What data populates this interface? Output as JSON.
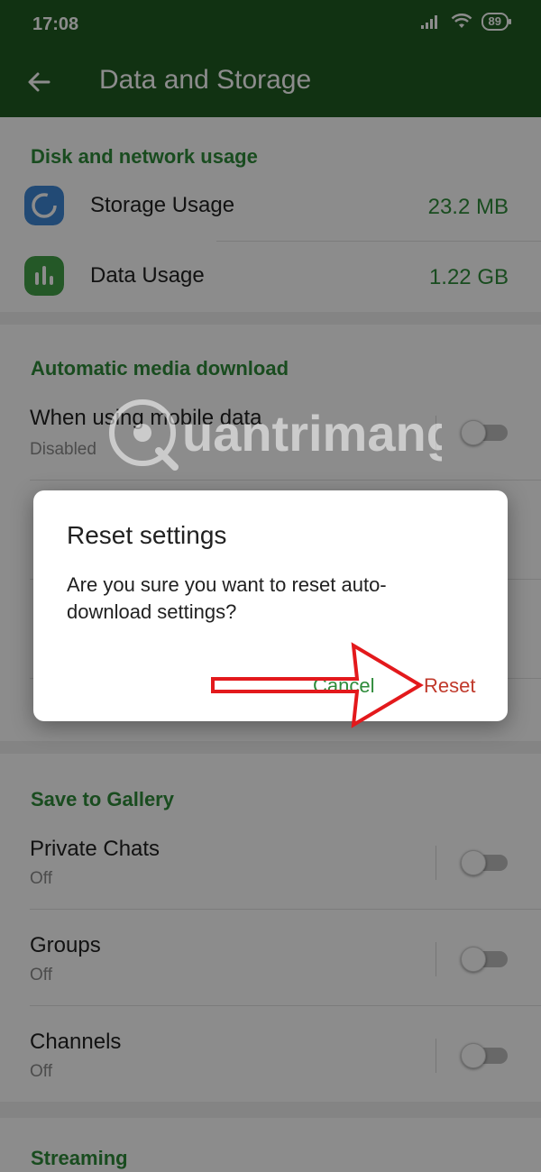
{
  "status_bar": {
    "time": "17:08",
    "battery": "89"
  },
  "app_bar": {
    "title": "Data and Storage"
  },
  "disk_section": {
    "title": "Disk and network usage",
    "items": [
      {
        "label": "Storage Usage",
        "value": "23.2 MB",
        "icon": "storage-ring-icon",
        "icon_color": "#3f88d6"
      },
      {
        "label": "Data Usage",
        "value": "1.22 GB",
        "icon": "bar-chart-icon",
        "icon_color": "#43a047"
      }
    ]
  },
  "auto_download": {
    "title": "Automatic media download",
    "rows": [
      {
        "label": "When using mobile data",
        "sub": "Disabled"
      }
    ]
  },
  "gallery_section": {
    "title": "Save to Gallery",
    "rows": [
      {
        "label": "Private Chats",
        "sub": "Off"
      },
      {
        "label": "Groups",
        "sub": "Off"
      },
      {
        "label": "Channels",
        "sub": "Off"
      }
    ]
  },
  "streaming_section": {
    "title": "Streaming"
  },
  "dialog": {
    "title": "Reset settings",
    "message": "Are you sure you want to reset auto-download settings?",
    "cancel_label": "Cancel",
    "reset_label": "Reset"
  },
  "watermark": {
    "text": "Quantrimang"
  },
  "colors": {
    "header_green": "#1f5b22",
    "accent_green": "#2e8b3a",
    "reset_red": "#c0392b",
    "annotation_arrow_red": "#e3191c"
  }
}
